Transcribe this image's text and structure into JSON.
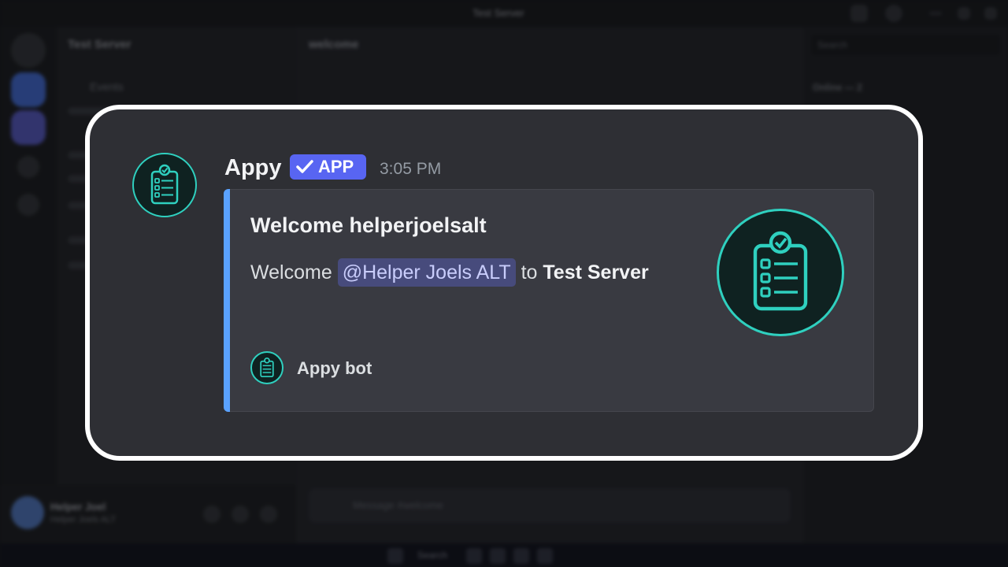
{
  "window": {
    "title": "Test Server"
  },
  "sidebar": {
    "server_name": "Test Server",
    "channels": [
      "Events"
    ]
  },
  "channel_header": {
    "name": "welcome"
  },
  "user_panel": {
    "name": "Helper Joel",
    "status": "Helper Joels ALT"
  },
  "composer": {
    "placeholder": "Message #welcome"
  },
  "members": {
    "search_placeholder": "Search",
    "group_label": "Online — 2"
  },
  "taskbar": {
    "search_label": "Search"
  },
  "message": {
    "author": "Appy",
    "badge": "APP",
    "timestamp": "3:05 PM",
    "embed": {
      "title": "Welcome helperjoelsalt",
      "desc_prefix": "Welcome",
      "mention": "@Helper Joels ALT",
      "desc_mid": "to",
      "server": "Test Server",
      "footer": "Appy bot",
      "accent_color": "#5aa2ff"
    }
  },
  "colors": {
    "badge": "#5865f2",
    "icon_teal": "#2fd0bf",
    "mention_bg": "#474b7c"
  },
  "icons": {
    "avatar": "clipboard-check-icon",
    "badge": "checkmark-icon"
  }
}
